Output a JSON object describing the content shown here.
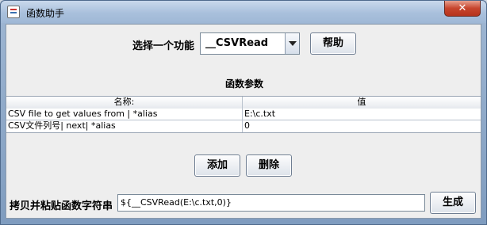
{
  "window": {
    "title": "函数助手",
    "close_glyph": "✕"
  },
  "function_picker": {
    "label": "选择一个功能",
    "selected": "__CSVRead"
  },
  "help_button": "帮助",
  "params": {
    "section_title": "函数参数",
    "columns": [
      "名称:",
      "值"
    ],
    "rows": [
      [
        "CSV file to get values from | *alias",
        "E:\\c.txt"
      ],
      [
        "CSV文件列号| next| *alias",
        "0"
      ]
    ]
  },
  "add_button": "添加",
  "delete_button": "删除",
  "output": {
    "label": "拷贝并粘贴函数字符串",
    "value": "${__CSVRead(E:\\c.txt,0)}",
    "generate_button": "生成"
  }
}
